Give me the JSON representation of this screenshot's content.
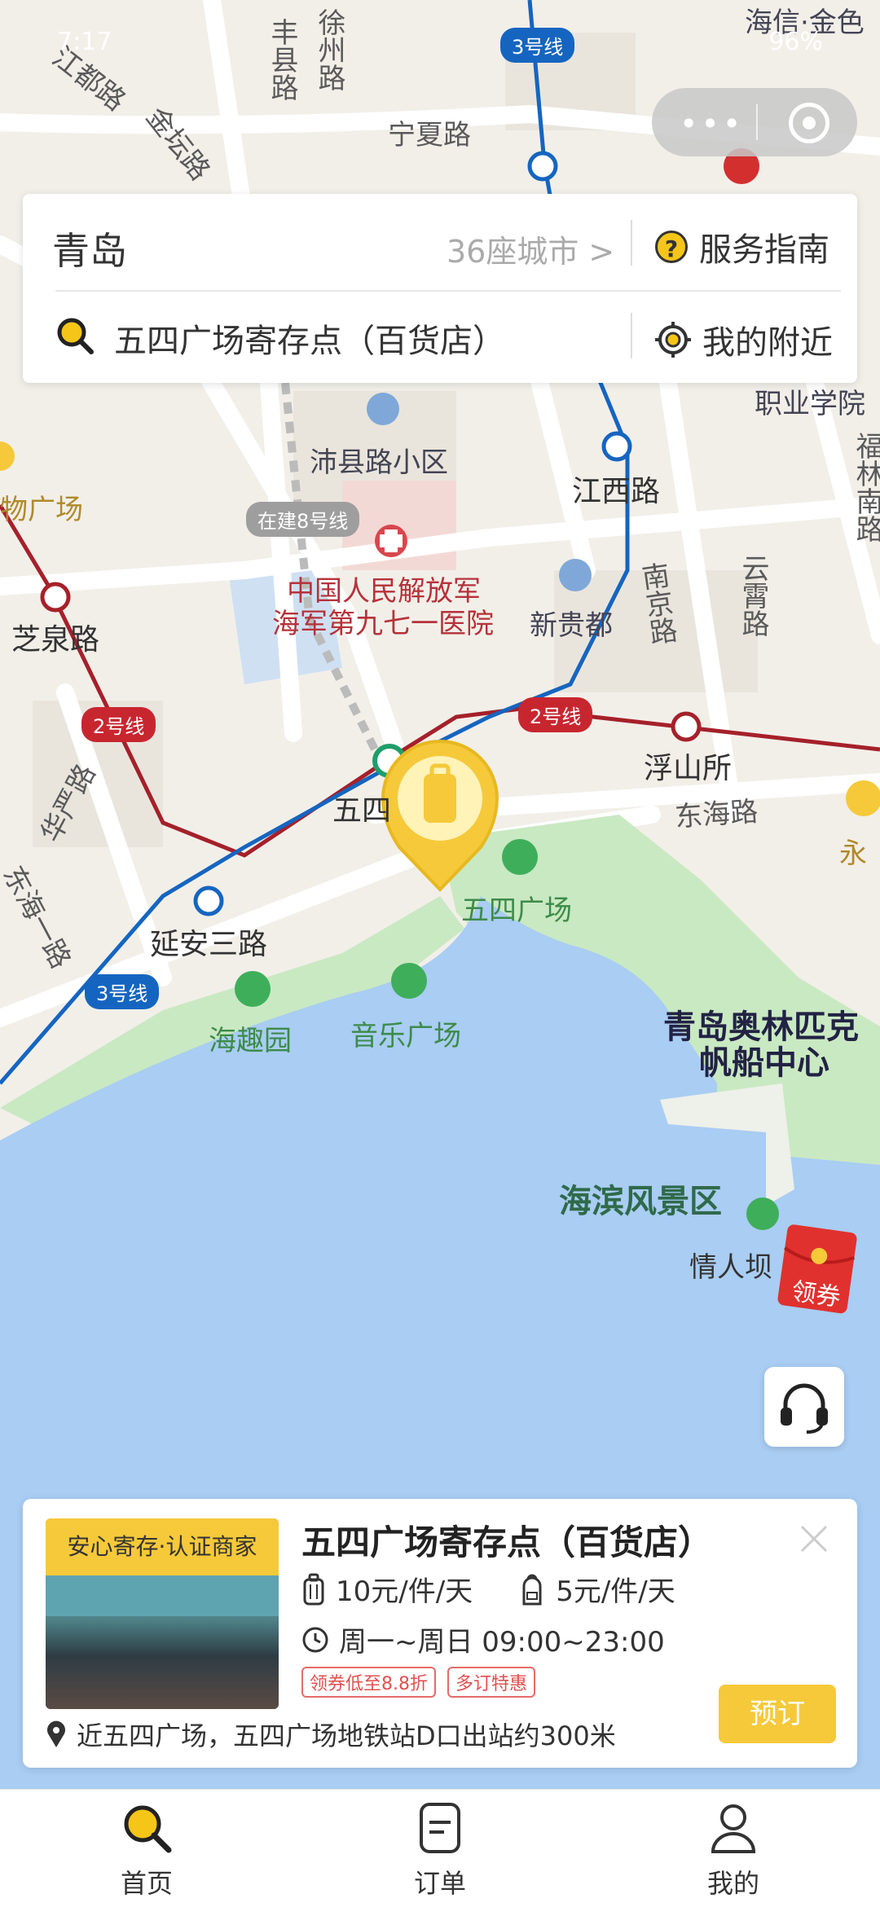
{
  "status_bar": {
    "time": "7:17",
    "battery": "96%"
  },
  "search_card": {
    "city": "青岛",
    "city_count": "36座城市 >",
    "service_guide": "服务指南",
    "query": "五四广场寄存点（百货店）",
    "nearby": "我的附近"
  },
  "map": {
    "roads": [
      "丰县路",
      "徐州路",
      "江都路",
      "金坛路",
      "宁夏路",
      "云霄路",
      "南京路",
      "东海路",
      "福林南路",
      "华严路",
      "东海一路"
    ],
    "metro_stations": [
      "江西路",
      "芝泉路",
      "浮山所",
      "五四",
      "延安三路"
    ],
    "metro_lines": [
      "3号线",
      "2号线",
      "在建8号线"
    ],
    "pois": [
      "沛县路小区",
      "新贵都",
      "中国人民解放军",
      "海军第九七一医院",
      "五四广场",
      "海趣园",
      "音乐广场",
      "物广场",
      "职业学院",
      "海信·金色",
      "永"
    ],
    "landmarks": [
      "青岛奥林匹克",
      "帆船中心",
      "海滨风景区",
      "情人坝"
    ]
  },
  "coupon": {
    "label": "领券"
  },
  "store_card": {
    "badge": "安心寄存·认证商家",
    "name": "五四广场寄存点（百货店）",
    "price_luggage": "10元/件/天",
    "price_bag": "5元/件/天",
    "hours": "周一~周日 09:00~23:00",
    "tags": [
      "领券低至8.8折",
      "多订特惠"
    ],
    "address": "近五四广场，五四广场地铁站D口出站约300米",
    "book_button": "预订"
  },
  "tab_bar": {
    "tabs": [
      {
        "label": "首页"
      },
      {
        "label": "订单"
      },
      {
        "label": "我的"
      }
    ]
  },
  "colors": {
    "brand_yellow": "#f5c93a",
    "metro_red": "#a5202a",
    "metro_blue": "#1565c0",
    "sea_blue": "#a9cdf3"
  }
}
